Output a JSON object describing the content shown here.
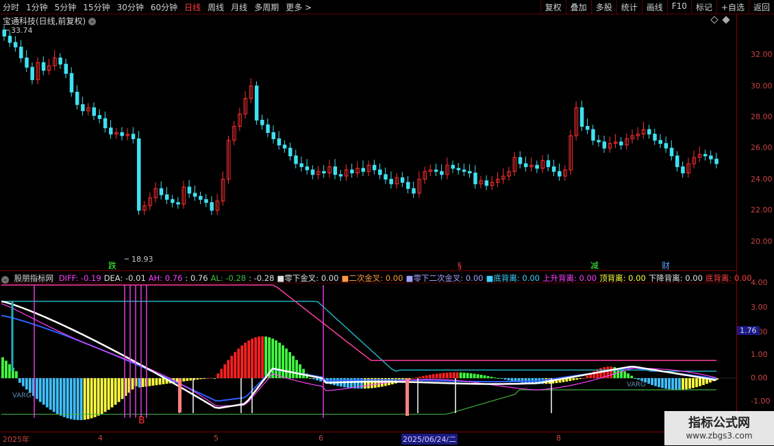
{
  "toolbar": {
    "periods": [
      "分时",
      "1分钟",
      "5分钟",
      "15分钟",
      "30分钟",
      "60分钟",
      "日线",
      "周线",
      "月线",
      "多周期",
      "更多 >"
    ],
    "active_period": "日线",
    "actions": [
      "复权",
      "叠加",
      "多股",
      "统计",
      "画线",
      "F10",
      "标记",
      "+自选",
      "返回"
    ]
  },
  "chart": {
    "title": "宝通科技(日线,前复权)",
    "high_label": "33.74",
    "low_label": "18.93",
    "price_ticks": [
      "32.00",
      "30.00",
      "28.00",
      "26.00",
      "24.00",
      "22.00",
      "20.00"
    ],
    "markers": [
      {
        "text": "跌",
        "color": "#3cff3c"
      },
      {
        "text": "§",
        "color": "#ff4040"
      },
      {
        "text": "减",
        "color": "#3cff3c"
      },
      {
        "text": "财",
        "color": "#5aa0ff"
      }
    ]
  },
  "indicator": {
    "name": "股朋指标网",
    "values": [
      {
        "text": "DIFF: -0.19",
        "color": "#ff40ff"
      },
      {
        "text": "DEA: -0.01",
        "color": "#e0e0e0"
      },
      {
        "text": "AH: 0.76",
        "color": "#ff40ff"
      },
      {
        "text": ": 0.76",
        "color": "#e0e0e0"
      },
      {
        "text": "AL: -0.28",
        "color": "#40c040"
      },
      {
        "text": ": -0.28",
        "color": "#e0e0e0"
      },
      {
        "text": "■零下金叉: 0.00",
        "color": "#e0e0e0"
      },
      {
        "text": "■二次金叉: 0.00",
        "color": "#ff9a40"
      },
      {
        "text": "■零下二次金叉: 0.00",
        "color": "#a0a0ff"
      },
      {
        "text": "■底背离: 0.00",
        "color": "#40d0ff"
      },
      {
        "text": "上升背离: 0.00",
        "color": "#ff40ff"
      },
      {
        "text": "顶背离: 0.00",
        "color": "#ffff40"
      },
      {
        "text": "下降背离: 0.00",
        "color": "#e0e0e0"
      },
      {
        "text": "底背离: 0.00",
        "color": "#ff4040"
      }
    ],
    "ticks": [
      "4.00",
      "3.00",
      "2.00",
      "1.00",
      "0.00",
      "-1.00"
    ],
    "current_value": "1.76",
    "buy_marker": "B",
    "varg_label": "VARG"
  },
  "dates": {
    "labels": [
      "2025年",
      "4",
      "5",
      "6",
      "2025/06/24/二",
      "8"
    ],
    "selected": "2025/06/24/二"
  },
  "watermark": {
    "line1": "指标公式网",
    "line2": "www.zbgs3.com"
  }
}
